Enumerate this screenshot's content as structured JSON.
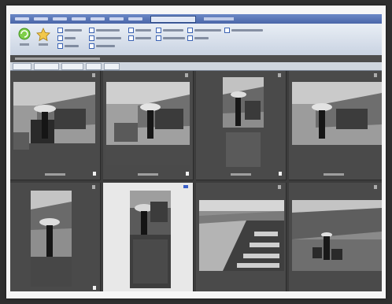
{
  "menu": {
    "items": [
      "",
      "",
      "",
      "",
      "",
      "",
      ""
    ],
    "search_value": "",
    "extra": ""
  },
  "ribbon": {
    "options": [
      "",
      "",
      "",
      "",
      "",
      "",
      "",
      "",
      "",
      "",
      "",
      "",
      ""
    ]
  },
  "path_bar": {
    "path": ""
  },
  "tabs": [
    "",
    "",
    "",
    "",
    ""
  ],
  "thumbnails": [
    {
      "caption": "",
      "number": ""
    },
    {
      "caption": "",
      "number": ""
    },
    {
      "caption": "",
      "number": ""
    },
    {
      "caption": "",
      "number": ""
    },
    {
      "caption": "",
      "number": ""
    },
    {
      "caption": "",
      "number": ""
    },
    {
      "caption": "",
      "number": ""
    },
    {
      "caption": "",
      "number": ""
    }
  ],
  "colors": {
    "menubar": "#5673b4",
    "ribbon": "#dfe5ee",
    "grid": "#3c3c3c",
    "selected": "#e8e8e8",
    "accent": "#3a5fc8"
  },
  "icons": [
    "refresh-icon",
    "star-icon"
  ]
}
